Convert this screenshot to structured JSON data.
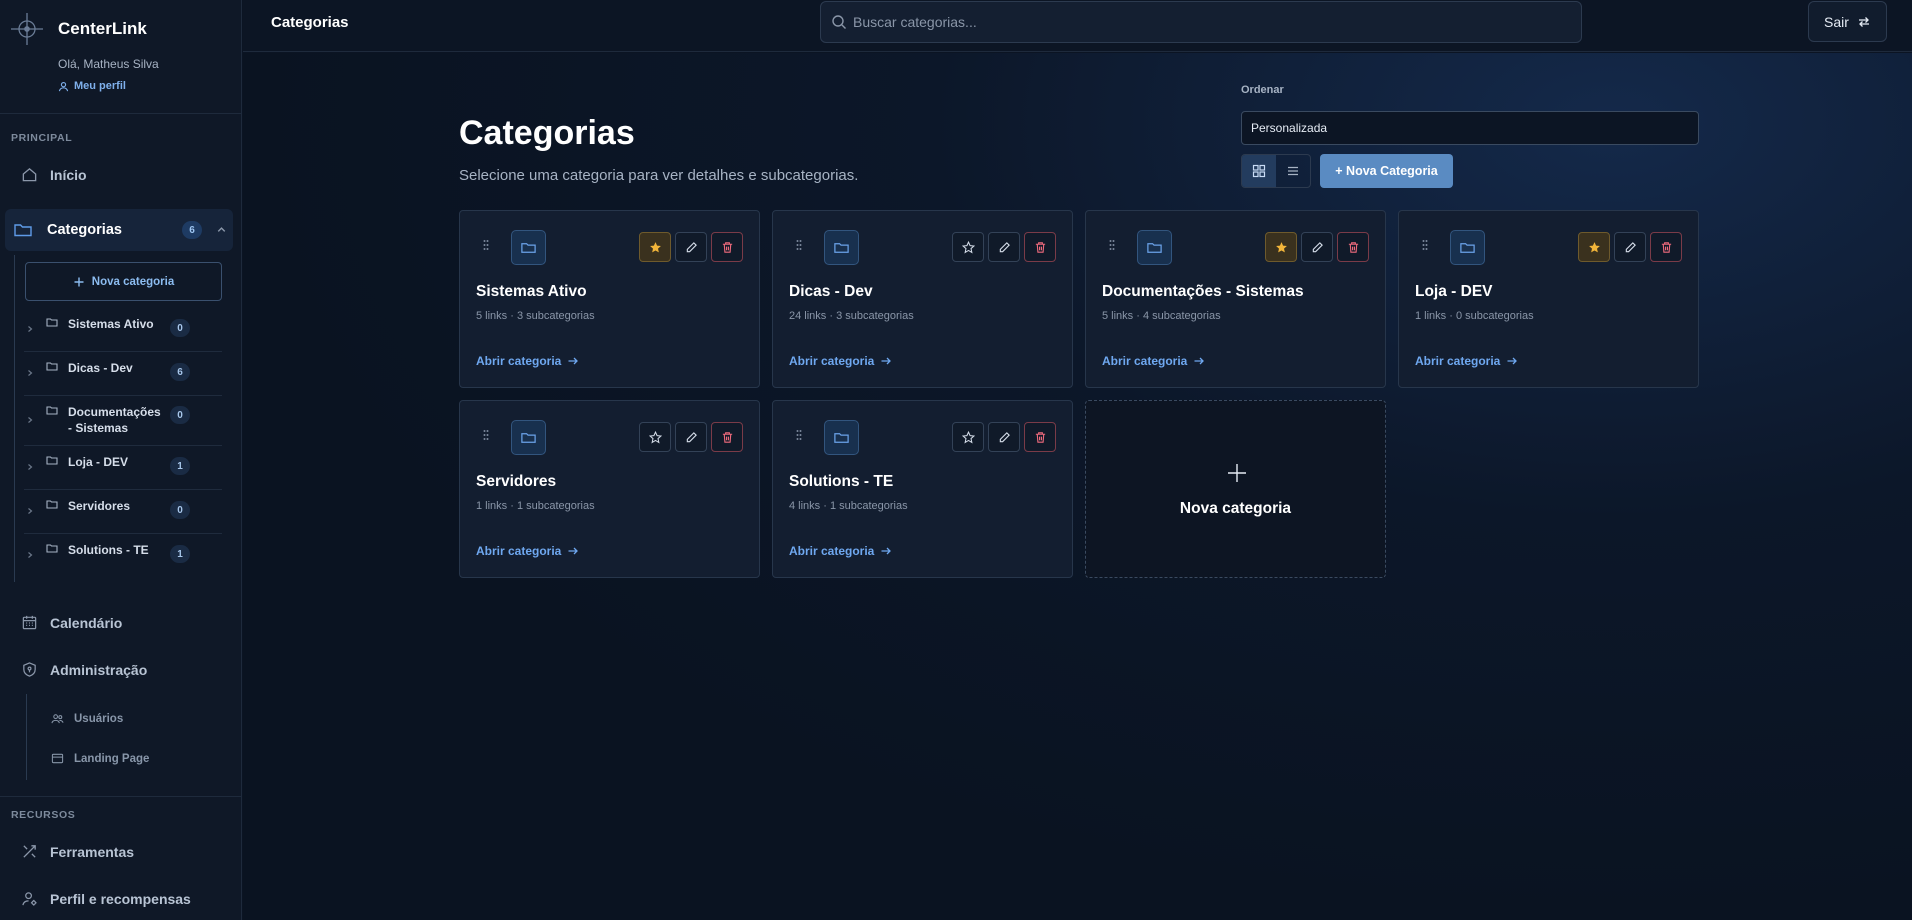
{
  "sidebar": {
    "brand_name": "CenterLink",
    "greeting": "Olá, Matheus Silva",
    "profile_link": "Meu perfil",
    "section_principal": "PRINCIPAL",
    "nav_inicio": "Início",
    "categories": {
      "label": "Categorias",
      "count": "6",
      "new_button": "Nova categoria",
      "items": [
        {
          "name": "Sistemas Ativo",
          "count": "0"
        },
        {
          "name": "Dicas - Dev",
          "count": "6"
        },
        {
          "name": "Documentações - Sistemas",
          "count": "0"
        },
        {
          "name": "Loja - DEV",
          "count": "1"
        },
        {
          "name": "Servidores",
          "count": "0"
        },
        {
          "name": "Solutions - TE",
          "count": "1"
        }
      ]
    },
    "nav_calendario": "Calendário",
    "nav_admin": "Administração",
    "admin_items": [
      "Usuários",
      "Landing Page"
    ],
    "section_recursos": "RECURSOS",
    "nav_ferramentas": "Ferramentas",
    "nav_perfil": "Perfil e recompensas"
  },
  "topbar": {
    "title": "Categorias",
    "search_placeholder": "Buscar categorias...",
    "logout_label": "Sair"
  },
  "main": {
    "title": "Categorias",
    "subtitle": "Selecione uma categoria para ver detalhes e subcategorias.",
    "sort_label": "Ordenar",
    "sort_value": "Personalizada",
    "new_category_button": "+ Nova Categoria",
    "view_mode": "grid",
    "open_label": "Abrir categoria",
    "new_card_label": "Nova categoria",
    "cards": [
      {
        "name": "Sistemas Ativo",
        "meta": "5 links · 3 subcategorias",
        "favorite": true
      },
      {
        "name": "Dicas - Dev",
        "meta": "24 links · 3 subcategorias",
        "favorite": false
      },
      {
        "name": "Documentações - Sistemas",
        "meta": "5 links · 4 subcategorias",
        "favorite": true
      },
      {
        "name": "Loja - DEV",
        "meta": "1 links · 0 subcategorias",
        "favorite": true
      },
      {
        "name": "Servidores",
        "meta": "1 links · 1 subcategorias",
        "favorite": false
      },
      {
        "name": "Solutions - TE",
        "meta": "4 links · 1 subcategorias",
        "favorite": false
      }
    ]
  },
  "colors": {
    "accent": "#5a8bc2",
    "link": "#6fa8f0",
    "favorite": "#f2b53a",
    "danger": "#ef6b7d"
  }
}
